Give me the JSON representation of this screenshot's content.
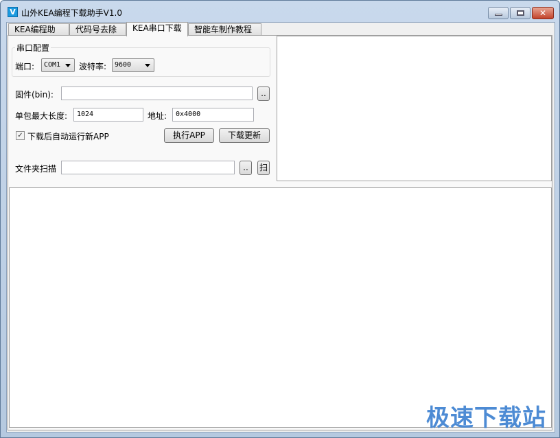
{
  "window": {
    "title": "山外KEA编程下载助手V1.0",
    "icon": "app-v-icon",
    "icon_letter": "V",
    "close_glyph": "✕"
  },
  "tabs": [
    {
      "label": "KEA编程助手"
    },
    {
      "label": "代码号去除"
    },
    {
      "label": "KEA串口下载",
      "active": true
    },
    {
      "label": "智能车制作教程"
    }
  ],
  "serial": {
    "group_label": "串口配置",
    "port_label": "端口:",
    "port_value": "COM1",
    "baud_label": "波特率:",
    "baud_value": "9600"
  },
  "firmware": {
    "label": "固件(bin):",
    "value": "",
    "browse": ".."
  },
  "packet": {
    "label": "单包最大长度:",
    "value": "1024",
    "addr_label": "地址:",
    "addr_value": "0x4000"
  },
  "auto_run": {
    "label": "下载后自动运行新APP",
    "checked": true,
    "check_glyph": "✓"
  },
  "buttons": {
    "run_app": "执行APP",
    "download": "下载更新"
  },
  "folder": {
    "label": "文件夹扫描",
    "value": "",
    "browse": "..",
    "scan": "扫"
  },
  "watermark": "极速下载站"
}
